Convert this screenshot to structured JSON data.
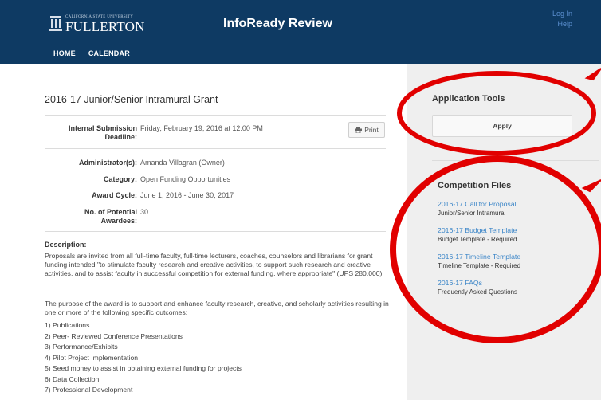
{
  "header": {
    "logo_small": "CALIFORNIA STATE UNIVERSITY",
    "logo_big": "FULLERTON",
    "app_title": "InfoReady Review",
    "login_label": "Log In",
    "help_label": "Help",
    "nav": [
      {
        "label": "HOME"
      },
      {
        "label": "CALENDAR"
      }
    ],
    "colors": {
      "bar": "#0e3a63",
      "link": "#5b8fd0"
    }
  },
  "competition": {
    "title": "2016-17 Junior/Senior Intramural Grant",
    "print_label": "Print",
    "fields": [
      {
        "label": "Internal Submission Deadline:",
        "value": "Friday, February 19, 2016 at 12:00 PM"
      },
      {
        "label": "Administrator(s):",
        "value": "Amanda Villagran (Owner)"
      },
      {
        "label": "Category:",
        "value": "Open Funding Opportunities"
      },
      {
        "label": "Award Cycle:",
        "value": "June 1, 2016 - June 30, 2017"
      },
      {
        "label": "No. of Potential Awardees:",
        "value": "30"
      }
    ],
    "description_heading": "Description:",
    "description_p1": "Proposals are invited from all full-time faculty, full-time lecturers, coaches, counselors and librarians for grant funding intended \"to stimulate faculty research and creative activities, to support such research and creative activities, and to assist faculty in successful competition for external funding, where appropriate\" (UPS 280.000).",
    "description_p2": "The purpose of the award is to support and enhance faculty research, creative, and scholarly activities resulting in one or more of the following specific outcomes:",
    "outcomes": [
      "1) Publications",
      "2) Peer- Reviewed Conference Presentations",
      "3) Performance/Exhibits",
      "4) Pilot Project Implementation",
      "5) Seed money to assist in obtaining external funding for projects",
      "6) Data Collection",
      "7) Professional Development"
    ]
  },
  "sidebar": {
    "tools_heading": "Application Tools",
    "apply_label": "Apply",
    "files_heading": "Competition Files",
    "files": [
      {
        "link": "2016-17 Call for Proposal",
        "desc": "Junior/Senior Intramural"
      },
      {
        "link": "2016-17 Budget Template",
        "desc": "Budget Template - Required"
      },
      {
        "link": "2016-17 Timeline Template",
        "desc": "Timeline Template - Required"
      },
      {
        "link": "2016-17 FAQs",
        "desc": "Frequently Asked Questions"
      }
    ],
    "colors": {
      "background": "#efefef",
      "file_link": "#3c86c8"
    }
  },
  "annotation": {
    "color": "#e10000"
  },
  "icons": [
    "university-seal-icon",
    "printer-icon",
    "red-arrow-icon"
  ]
}
